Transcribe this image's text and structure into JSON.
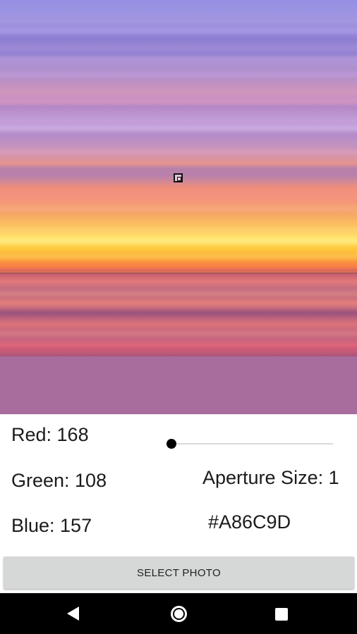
{
  "swatch": {
    "color": "#A86C9D"
  },
  "color_readout": {
    "red_label": "Red: 168",
    "green_label": "Green: 108",
    "blue_label": "Blue: 157",
    "hex_label": "#A86C9D"
  },
  "aperture": {
    "label": "Aperture Size: 1",
    "slider_fraction": 0.0
  },
  "actions": {
    "select_photo_label": "SELECT PHOTO"
  },
  "navbar": {
    "back_icon": "back-triangle-icon",
    "home_icon": "home-circle-icon",
    "recents_icon": "recents-square-icon"
  }
}
